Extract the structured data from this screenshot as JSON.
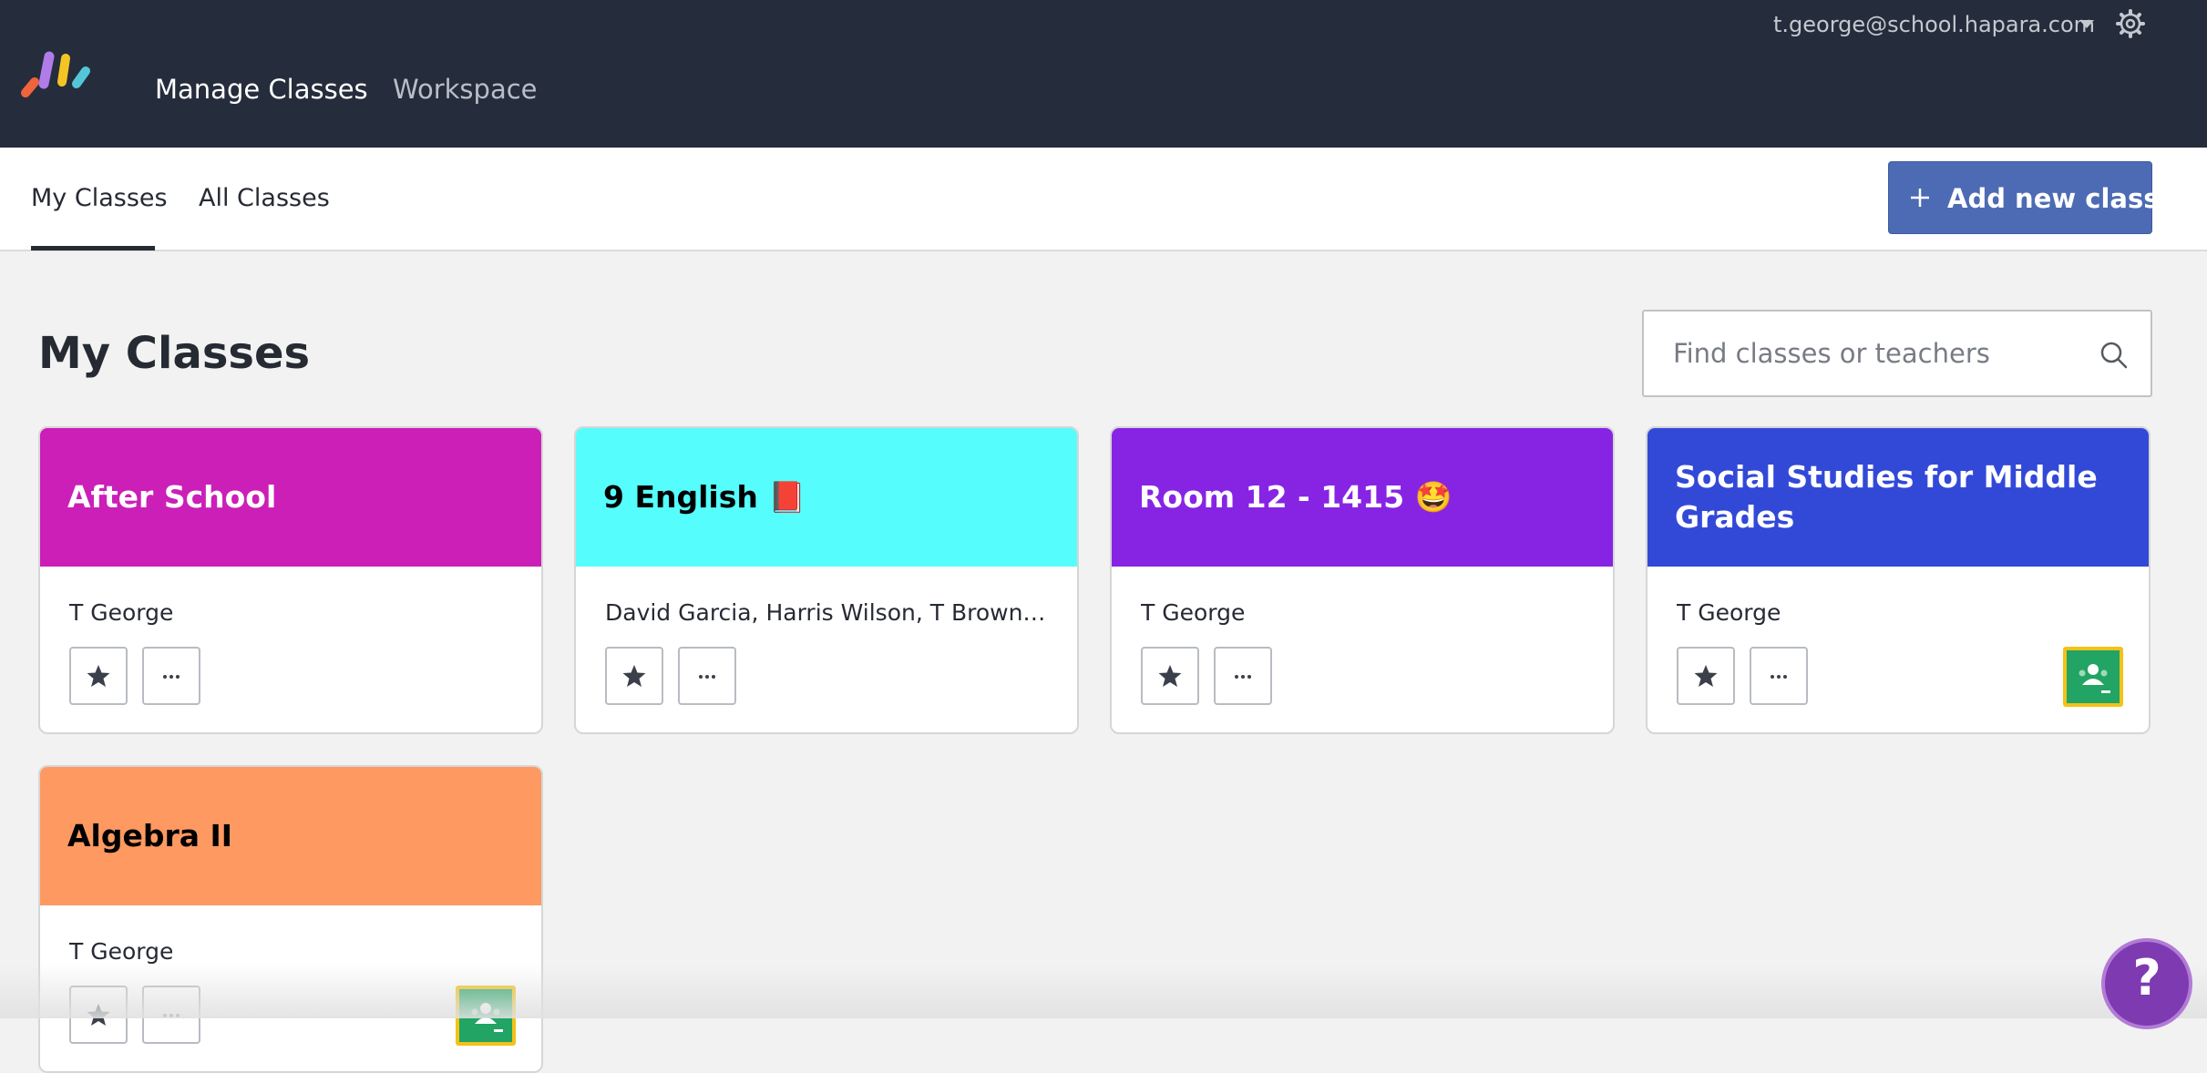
{
  "header": {
    "nav": [
      {
        "label": "Manage Classes",
        "active": true
      },
      {
        "label": "Workspace",
        "active": false
      }
    ],
    "account_email": "t.george@school.hapara.com"
  },
  "subnav": {
    "tabs": [
      {
        "label": "My Classes",
        "active": true
      },
      {
        "label": "All Classes",
        "active": false
      }
    ],
    "add_button_label": "Add new class"
  },
  "main": {
    "title": "My Classes",
    "search_placeholder": "Find classes or teachers",
    "classes": [
      {
        "name": "After School",
        "teachers": "T George",
        "color": "#cb1fb8",
        "text_color": "#ffffff",
        "google_classroom": false
      },
      {
        "name": "9 English 📕",
        "teachers": "David Garcia, Harris Wilson, T Brown, T Clark",
        "color": "#55fdfd",
        "text_color": "#000000",
        "google_classroom": false
      },
      {
        "name": "Room 12 - 1415 🤩",
        "teachers": "T George",
        "color": "#8724e4",
        "text_color": "#ffffff",
        "google_classroom": false
      },
      {
        "name": "Social Studies for Middle Grades",
        "teachers": "T George",
        "color": "#3249d8",
        "text_color": "#ffffff",
        "google_classroom": true
      },
      {
        "name": "Algebra II",
        "teachers": "T George",
        "color": "#fe9961",
        "text_color": "#000000",
        "google_classroom": true
      }
    ]
  },
  "icons": {
    "logo": "hapara-logo",
    "settings": "gear-icon",
    "search": "search-icon",
    "favorite": "star-icon",
    "more": "ellipsis-icon",
    "google_classroom": "google-classroom-icon",
    "help": "help-icon"
  },
  "help_label": "?"
}
